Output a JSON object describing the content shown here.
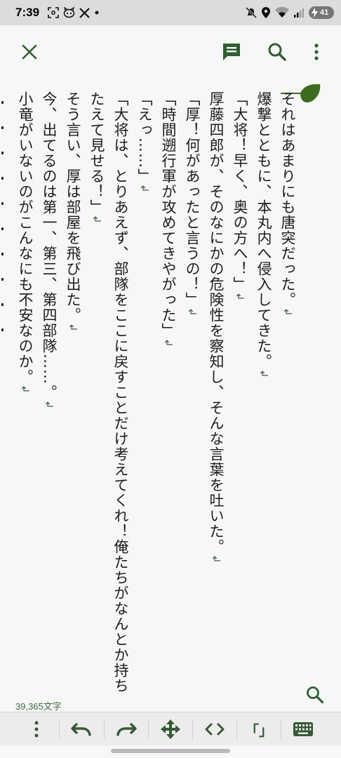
{
  "status_bar": {
    "time": "7:39",
    "battery_level": "41",
    "left_icons": [
      "screenshot-icon",
      "face-icon",
      "x-app-icon",
      "dot-icon"
    ],
    "right_icons": [
      "mute-icon",
      "location-icon",
      "wifi-icon",
      "signal-icon",
      "battery-icon"
    ]
  },
  "top_bar": {
    "icons": [
      "close-icon",
      "comment-icon",
      "search-icon",
      "more-vert-icon"
    ],
    "accent_color": "#2f5f2f"
  },
  "text": {
    "columns": [
      {
        "text": "それはあまりにも唐突だった。",
        "return_mark": true
      },
      {
        "text": "爆撃とともに、本丸内へ侵入してきた。",
        "return_mark": true
      },
      {
        "text": "「大将！早く、奥の方へ！」",
        "return_mark": true
      },
      {
        "text": "厚藤四郎が、そのなにかの危険性を察知し、そんな言葉を吐いた。",
        "return_mark": true
      },
      {
        "text": "「厚！何があったと言うの！」",
        "return_mark": true
      },
      {
        "text": "「時間遡行軍が攻めてきやがった」",
        "return_mark": true
      },
      {
        "text": "「えっ……」",
        "return_mark": true
      },
      {
        "text": "「大将は、とりあえず、部隊をここに戻すことだけ考えてくれ！俺たちがなんとか持ちこ",
        "return_mark": false
      },
      {
        "text": "たえて見せる！」",
        "return_mark": true
      },
      {
        "text": "そう言い、厚は部屋を飛び出た。",
        "return_mark": true
      },
      {
        "text": "今、出てるのは第一、第三、第四部隊……。",
        "return_mark": true
      },
      {
        "text": "小竜がいないのがこんなにも不安なのか。",
        "return_mark": true
      }
    ],
    "return_glyph": "↲",
    "text_color": "#1d1d1d"
  },
  "bookmark_color": "#3f6b21",
  "footer": {
    "char_count": "39,365文字",
    "search_icon": "search-icon"
  },
  "bottom_toolbar": {
    "buttons": [
      "more-vert-icon",
      "undo-icon",
      "redo-icon",
      "move-arrows-icon",
      "code-brackets-icon",
      "bracket-icon",
      "keyboard-icon"
    ],
    "bracket_label": "「」",
    "icon_color": "#375a37"
  }
}
